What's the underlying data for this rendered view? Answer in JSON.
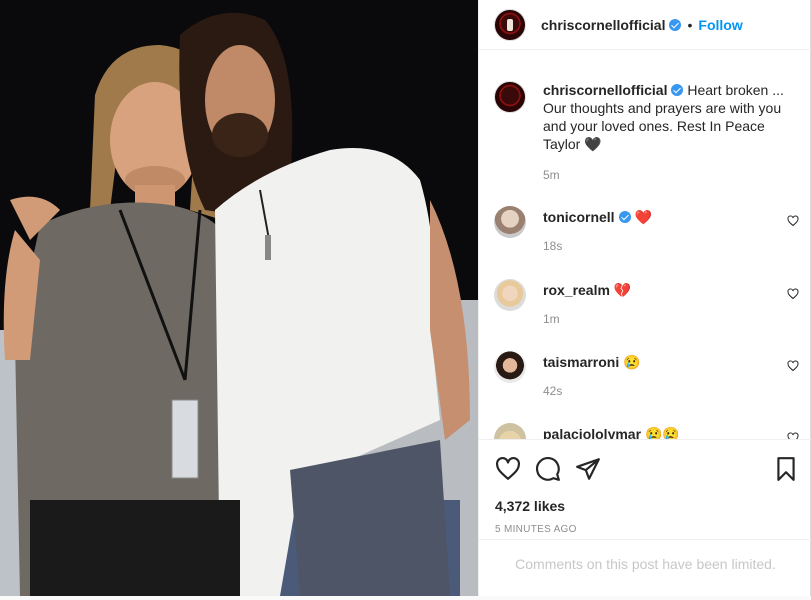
{
  "header": {
    "username": "chriscornellofficial",
    "separator": "•",
    "follow_label": "Follow"
  },
  "caption": {
    "username": "chriscornellofficial",
    "text": "Heart broken ... Our thoughts and prayers are with you and your loved ones. Rest In Peace Taylor 🖤",
    "time": "5m"
  },
  "comments": [
    {
      "username": "tonicornell",
      "text": "❤️",
      "time": "18s",
      "verified": true
    },
    {
      "username": "rox_realm",
      "text": "💔",
      "time": "1m",
      "verified": false
    },
    {
      "username": "taismarroni",
      "text": "😢",
      "time": "42s",
      "verified": false
    },
    {
      "username": "palaciololymar",
      "text": "😢😢",
      "time": "",
      "verified": false
    }
  ],
  "actions": {
    "icons": [
      "heart-icon",
      "comment-icon",
      "share-icon",
      "bookmark-icon"
    ],
    "likes": "4,372 likes",
    "posted": "5 MINUTES AGO",
    "limited_notice": "Comments on this post have been limited."
  }
}
